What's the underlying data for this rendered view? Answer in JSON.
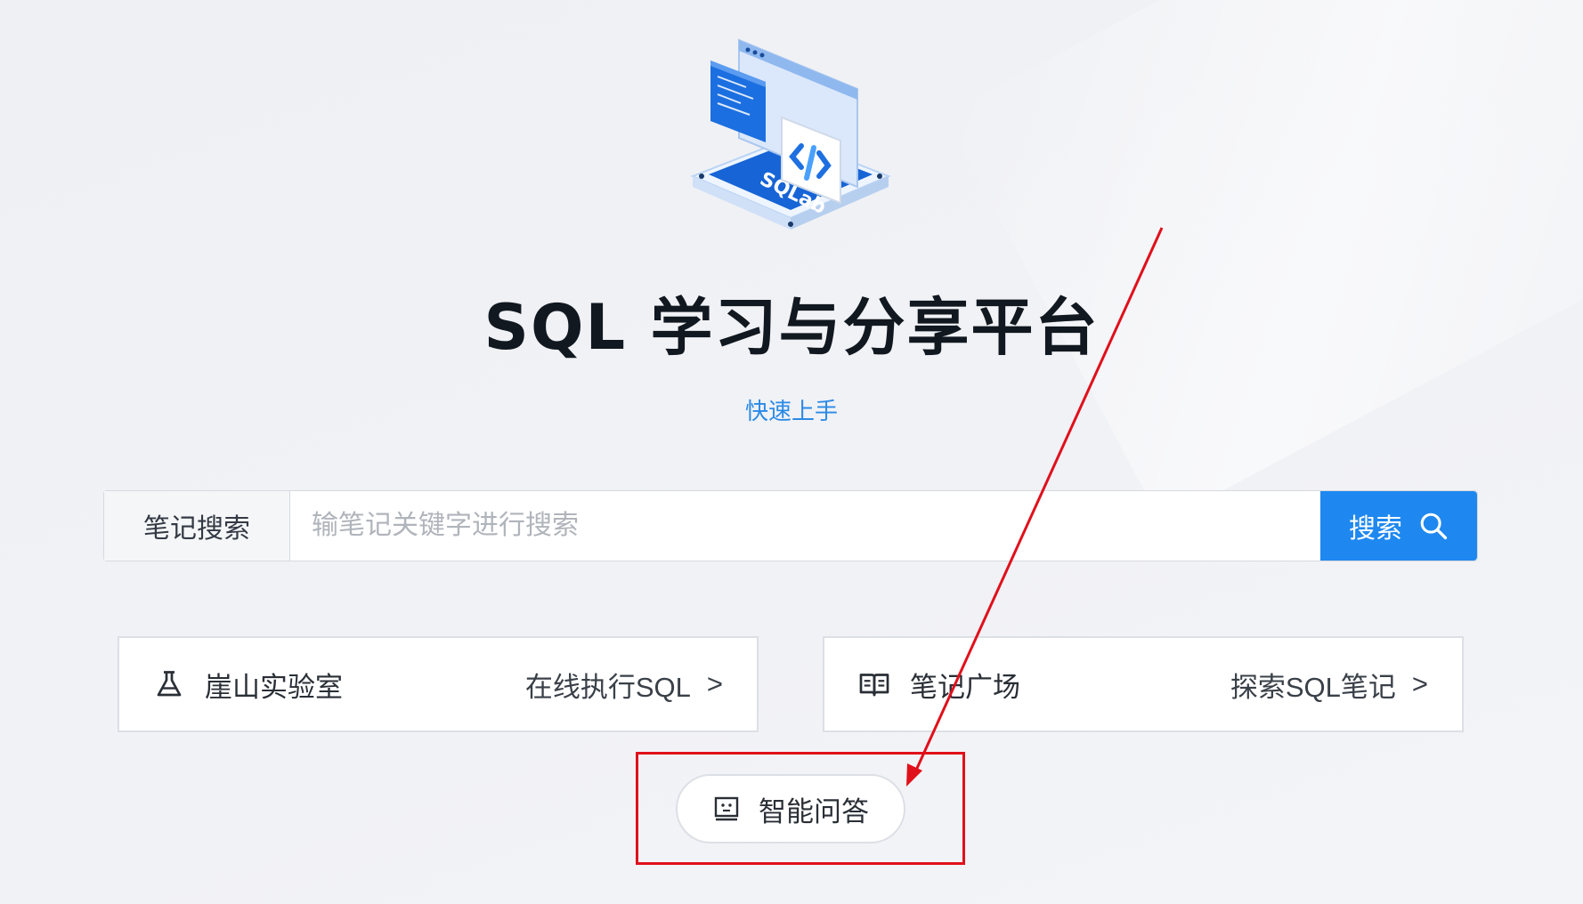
{
  "hero": {
    "logo_text": "SQLab",
    "title": "SQL 学习与分享平台",
    "quickstart_label": "快速上手"
  },
  "search": {
    "prefix_label": "笔记搜索",
    "placeholder": "输笔记关键字进行搜索",
    "button_label": "搜索"
  },
  "cards": {
    "lab": {
      "label": "崖山实验室",
      "link": "在线执行SQL",
      "arrow": ">"
    },
    "notes": {
      "label": "笔记广场",
      "link": "探索SQL笔记",
      "arrow": ">"
    }
  },
  "qa": {
    "label": "智能问答"
  },
  "colors": {
    "accent": "#1e88f0",
    "link": "#2b8ae6",
    "annotation": "#e0101b"
  },
  "icons": {
    "search_button": "search-icon",
    "lab": "flask-icon",
    "notes": "book-icon",
    "qa": "robot-icon"
  }
}
